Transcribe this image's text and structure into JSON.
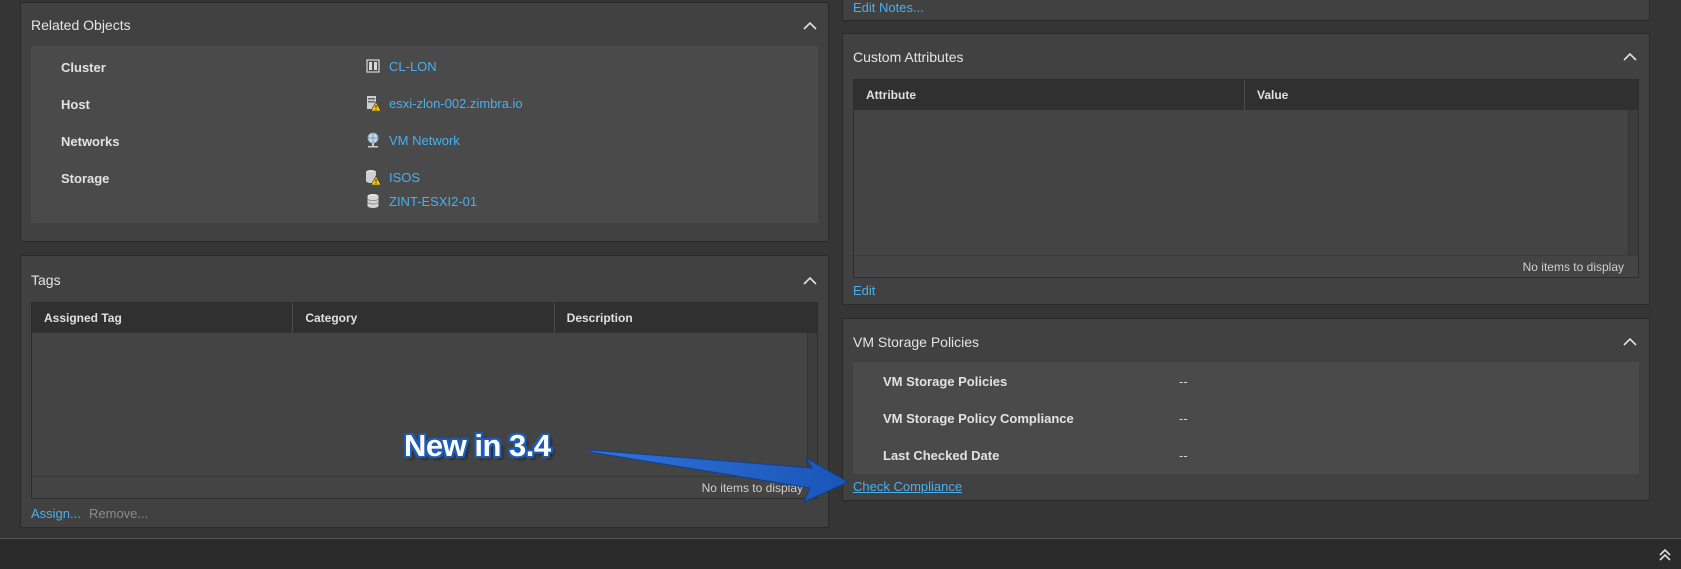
{
  "related_objects": {
    "title": "Related Objects",
    "rows": [
      {
        "label": "Cluster",
        "value": "CL-LON",
        "icon": "cluster-icon"
      },
      {
        "label": "Host",
        "value": "esxi-zlon-002.zimbra.io",
        "icon": "host-warning-icon"
      },
      {
        "label": "Networks",
        "value": "VM Network",
        "icon": "network-icon"
      },
      {
        "label": "Storage",
        "value": "ISOS",
        "icon": "datastore-warning-icon"
      }
    ],
    "storage_extra": {
      "value": "ZINT-ESXI2-01",
      "icon": "datastore-icon"
    }
  },
  "tags": {
    "title": "Tags",
    "columns": [
      "Assigned Tag",
      "Category",
      "Description"
    ],
    "empty_text": "No items to display",
    "assign_label": "Assign...",
    "remove_label": "Remove..."
  },
  "notes": {
    "edit_label": "Edit Notes..."
  },
  "custom_attributes": {
    "title": "Custom Attributes",
    "columns": [
      "Attribute",
      "Value"
    ],
    "empty_text": "No items to display",
    "edit_label": "Edit"
  },
  "vm_storage_policies": {
    "title": "VM Storage Policies",
    "rows": [
      {
        "label": "VM Storage Policies",
        "value": "--"
      },
      {
        "label": "VM Storage Policy Compliance",
        "value": "--"
      },
      {
        "label": "Last Checked Date",
        "value": "--"
      }
    ],
    "check_label": "Check Compliance"
  },
  "annotation": {
    "text": "New in 3.4",
    "color": "#1d5bb5"
  },
  "colors": {
    "link": "#49b0ee",
    "panel": "#414141",
    "background": "#353535"
  }
}
